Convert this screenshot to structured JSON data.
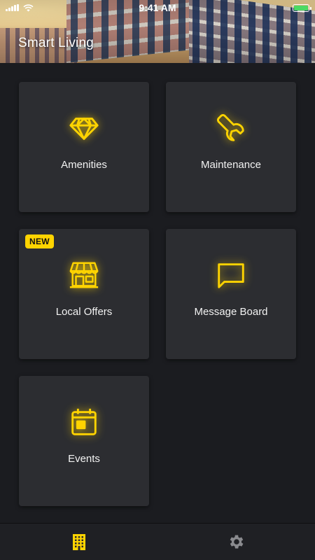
{
  "status_bar": {
    "time": "9:41 AM",
    "battery_percent": 100
  },
  "header": {
    "title": "Smart Living"
  },
  "tiles": [
    {
      "id": "amenities",
      "label": "Amenities",
      "icon": "diamond-icon"
    },
    {
      "id": "maintenance",
      "label": "Maintenance",
      "icon": "wrench-icon"
    },
    {
      "id": "local-offers",
      "label": "Local Offers",
      "icon": "storefront-icon",
      "badge": "NEW"
    },
    {
      "id": "message-board",
      "label": "Message Board",
      "icon": "chat-bubble-icon"
    },
    {
      "id": "events",
      "label": "Events",
      "icon": "calendar-icon"
    }
  ],
  "tab_bar": {
    "tabs": [
      {
        "id": "home",
        "icon": "building-icon",
        "active": true
      },
      {
        "id": "settings",
        "icon": "gear-icon",
        "active": false
      }
    ]
  },
  "colors": {
    "accent": "#ffd400",
    "tile_bg": "#2c2d31",
    "page_bg": "#1b1c20",
    "tab_inactive": "#8a8b8f"
  }
}
